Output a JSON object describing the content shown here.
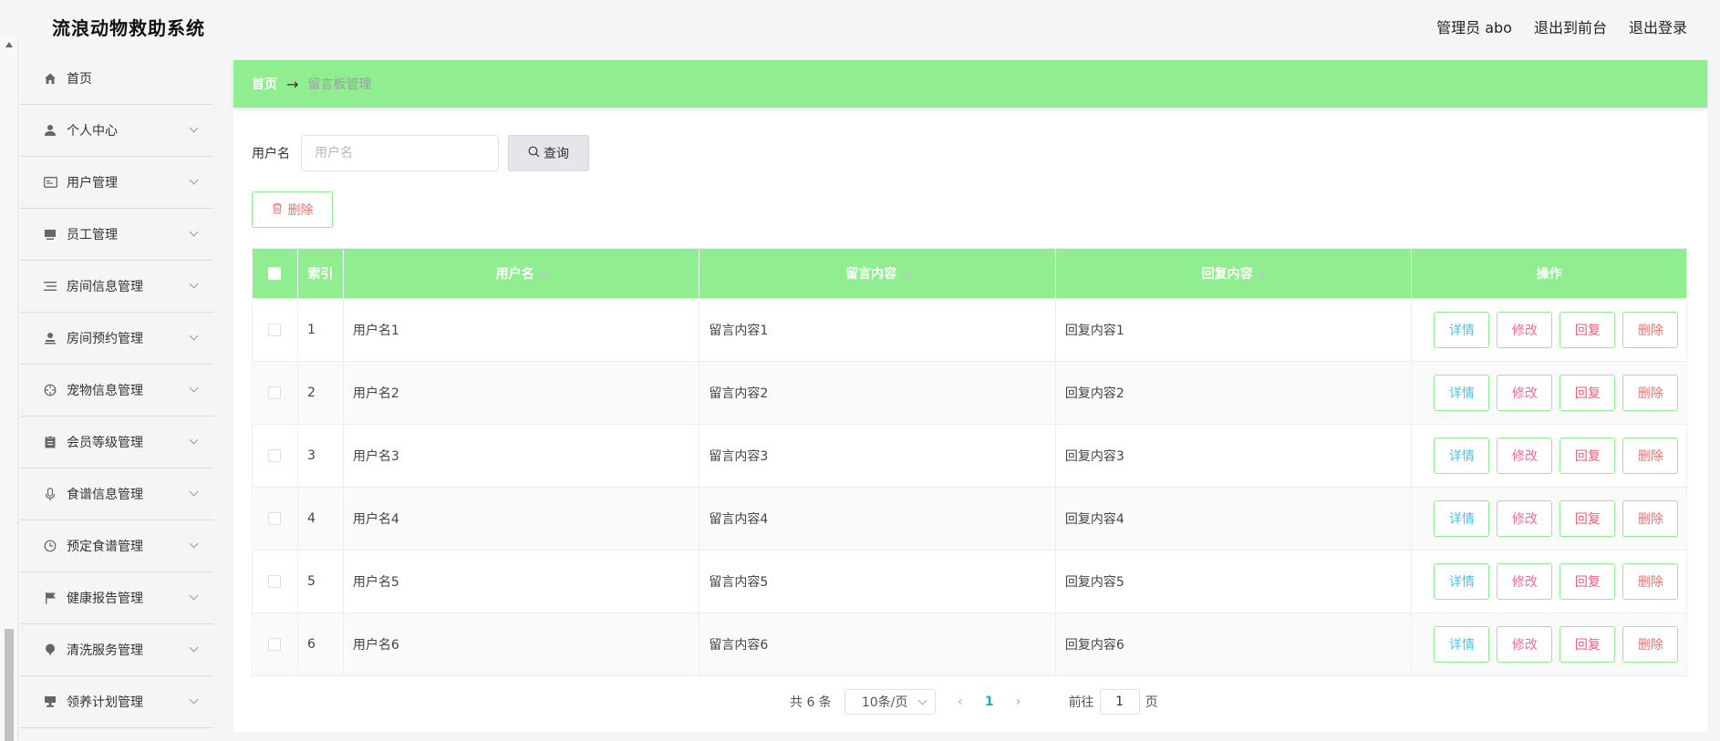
{
  "app": {
    "title": "流浪动物救助系统"
  },
  "header": {
    "user": "管理员 abo",
    "front": "退出到前台",
    "logout": "退出登录"
  },
  "sidebar": {
    "items": [
      {
        "label": "首页",
        "icon": "home-icon"
      },
      {
        "label": "个人中心",
        "icon": "person-icon"
      },
      {
        "label": "用户管理",
        "icon": "id-card-icon"
      },
      {
        "label": "员工管理",
        "icon": "monitor-icon"
      },
      {
        "label": "房间信息管理",
        "icon": "list-icon"
      },
      {
        "label": "房间预约管理",
        "icon": "user-stand-icon"
      },
      {
        "label": "宠物信息管理",
        "icon": "target-icon"
      },
      {
        "label": "会员等级管理",
        "icon": "clipboard-icon"
      },
      {
        "label": "食谱信息管理",
        "icon": "mic-icon"
      },
      {
        "label": "预定食谱管理",
        "icon": "clock-icon"
      },
      {
        "label": "健康报告管理",
        "icon": "flag-icon"
      },
      {
        "label": "清洗服务管理",
        "icon": "pin-icon"
      },
      {
        "label": "领养计划管理",
        "icon": "tv-icon"
      }
    ]
  },
  "breadcrumb": {
    "home": "首页",
    "arrow": "→",
    "current": "留言板管理"
  },
  "search": {
    "label": "用户名",
    "placeholder": "用户名",
    "button": "查询"
  },
  "toolbar": {
    "delete": "删除"
  },
  "table": {
    "columns": [
      "索引",
      "用户名",
      "留言内容",
      "回复内容",
      "操作"
    ],
    "rows": [
      {
        "index": "1",
        "username": "用户名1",
        "message": "留言内容1",
        "reply": "回复内容1"
      },
      {
        "index": "2",
        "username": "用户名2",
        "message": "留言内容2",
        "reply": "回复内容2"
      },
      {
        "index": "3",
        "username": "用户名3",
        "message": "留言内容3",
        "reply": "回复内容3"
      },
      {
        "index": "4",
        "username": "用户名4",
        "message": "留言内容4",
        "reply": "回复内容4"
      },
      {
        "index": "5",
        "username": "用户名5",
        "message": "留言内容5",
        "reply": "回复内容5"
      },
      {
        "index": "6",
        "username": "用户名6",
        "message": "留言内容6",
        "reply": "回复内容6"
      }
    ],
    "actions": {
      "detail": "详情",
      "edit": "修改",
      "reply": "回复",
      "delete": "删除"
    }
  },
  "pagination": {
    "total": "共 6 条",
    "page_size": "10条/页",
    "prev": "‹",
    "current": "1",
    "next": "›",
    "goto": "前往",
    "page_value": "1",
    "page_suffix": "页"
  },
  "colors": {
    "accent": "#90ee90",
    "danger": "#f56c6c",
    "info": "#4fc1e9",
    "pink": "#f76c97"
  }
}
